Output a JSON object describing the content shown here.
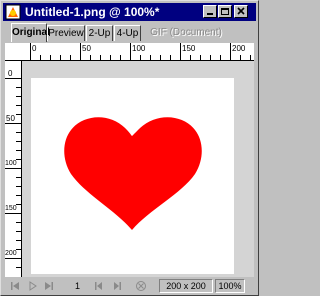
{
  "window": {
    "title": "Untitled-1.png @  100%*"
  },
  "tabs": [
    {
      "label": "Original",
      "active": true
    },
    {
      "label": "Preview",
      "active": false
    },
    {
      "label": "2-Up",
      "active": false
    },
    {
      "label": "4-Up",
      "active": false
    },
    {
      "label": "GIF (Document)",
      "active": false,
      "disabled": true
    }
  ],
  "ruler": {
    "top_labels": [
      "0",
      "50",
      "100",
      "150",
      "200"
    ],
    "left_labels": [
      "0",
      "50",
      "100",
      "150",
      "200"
    ]
  },
  "status": {
    "frame": "1",
    "dimensions": "200 x 200",
    "zoom": "100%"
  },
  "colors": {
    "heart": "#ff0000",
    "titlebar": "#000080",
    "canvas_bg": "#d4d4d4",
    "document_bg": "#ffffff"
  }
}
